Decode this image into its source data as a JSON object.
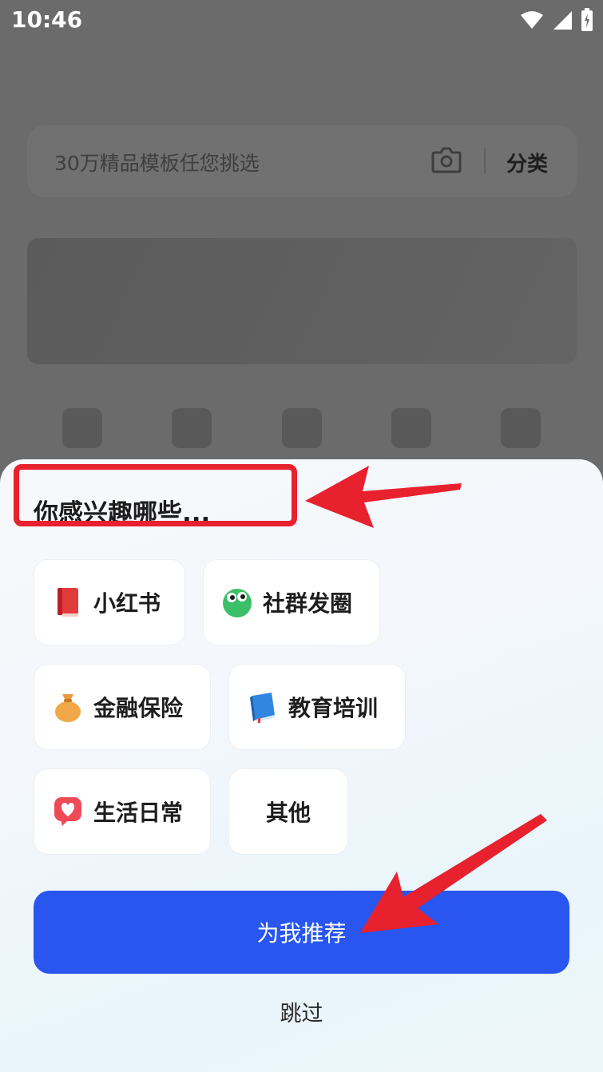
{
  "status_bar": {
    "time": "10:46",
    "icons": [
      "wifi-icon",
      "signal-icon",
      "battery-icon"
    ]
  },
  "search": {
    "placeholder": "30万精品模板任您挑选",
    "category_label": "分类",
    "icon": "camera-icon"
  },
  "sheet": {
    "title": "你感兴趣哪些...",
    "chips": [
      {
        "label": "小红书",
        "icon": "red-book-icon"
      },
      {
        "label": "社群发圈",
        "icon": "green-blob-icon"
      },
      {
        "label": "金融保险",
        "icon": "money-bag-icon"
      },
      {
        "label": "教育培训",
        "icon": "blue-book-icon"
      },
      {
        "label": "生活日常",
        "icon": "heart-bubble-icon"
      },
      {
        "label": "其他",
        "icon": ""
      }
    ],
    "recommend_label": "为我推荐",
    "skip_label": "跳过"
  },
  "colors": {
    "accent": "#2856ee",
    "annotation_red": "#e8212e",
    "overlay": "#6b6b6b"
  }
}
